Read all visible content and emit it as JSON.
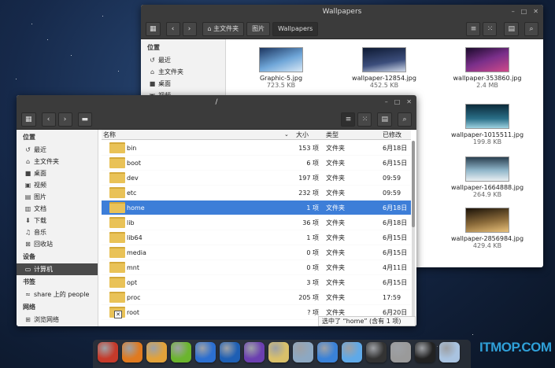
{
  "wallpapers_window": {
    "title": "Wallpapers",
    "window_controls": [
      "–",
      "□",
      "✕"
    ],
    "breadcrumb": [
      "主文件夹",
      "图片",
      "Wallpapers"
    ],
    "sidebar": {
      "header": "位置",
      "items": [
        {
          "icon": "history-icon",
          "glyph": "↺",
          "label": "最近"
        },
        {
          "icon": "home-icon",
          "glyph": "⌂",
          "label": "主文件夹"
        },
        {
          "icon": "desktop-icon",
          "glyph": "■",
          "label": "桌面"
        },
        {
          "icon": "video-icon",
          "glyph": "▣",
          "label": "视频"
        }
      ]
    },
    "files": [
      {
        "name": "Graphic-5.jpg",
        "size": "723.5 KB",
        "color": "#6fa6d8"
      },
      {
        "name": "wallpaper-12854.jpg",
        "size": "452.5 KB",
        "color": "#3c4e7c"
      },
      {
        "name": "wallpaper-353860.jpg",
        "size": "2.4 MB",
        "color": "#7a2f8a"
      },
      {
        "name": "wallpaper-1015511.jpg",
        "size": "199.8 KB",
        "color": "#2a6f88"
      },
      {
        "name": "wallpaper-1664888.jpg",
        "size": "264.9 KB",
        "color": "#8fb5c9"
      },
      {
        "name": "wallpaper-2856984.jpg",
        "size": "429.4 KB",
        "color": "#8a6a3a"
      }
    ]
  },
  "root_window": {
    "title": "/",
    "window_controls": [
      "–",
      "□",
      "✕"
    ],
    "sidebar": {
      "sections": [
        {
          "header": "位置",
          "items": [
            {
              "icon": "history-icon",
              "glyph": "↺",
              "label": "最近"
            },
            {
              "icon": "home-icon",
              "glyph": "⌂",
              "label": "主文件夹"
            },
            {
              "icon": "desktop-icon",
              "glyph": "■",
              "label": "桌面"
            },
            {
              "icon": "video-icon",
              "glyph": "▣",
              "label": "视频"
            },
            {
              "icon": "image-icon",
              "glyph": "▤",
              "label": "图片"
            },
            {
              "icon": "document-icon",
              "glyph": "▥",
              "label": "文档"
            },
            {
              "icon": "download-icon",
              "glyph": "⬇",
              "label": "下载"
            },
            {
              "icon": "music-icon",
              "glyph": "♫",
              "label": "音乐"
            },
            {
              "icon": "trash-icon",
              "glyph": "⊠",
              "label": "回收站"
            }
          ]
        },
        {
          "header": "设备",
          "items": [
            {
              "icon": "computer-icon",
              "glyph": "▭",
              "label": "计算机",
              "selected": true
            }
          ]
        },
        {
          "header": "书签",
          "items": [
            {
              "icon": "network-share-icon",
              "glyph": "≈",
              "label": "share 上的 people"
            }
          ]
        },
        {
          "header": "网络",
          "items": [
            {
              "icon": "browse-network-icon",
              "glyph": "⊞",
              "label": "浏览网络"
            }
          ]
        }
      ]
    },
    "columns": {
      "name": "名称",
      "size": "大小",
      "type": "类型",
      "modified": "已修改"
    },
    "rows": [
      {
        "name": "bin",
        "size": "153 项",
        "type": "文件夹",
        "modified": "6月18日"
      },
      {
        "name": "boot",
        "size": "6 项",
        "type": "文件夹",
        "modified": "6月15日"
      },
      {
        "name": "dev",
        "size": "197 项",
        "type": "文件夹",
        "modified": "09:59"
      },
      {
        "name": "etc",
        "size": "232 项",
        "type": "文件夹",
        "modified": "09:59"
      },
      {
        "name": "home",
        "size": "1 项",
        "type": "文件夹",
        "modified": "6月18日",
        "selected": true
      },
      {
        "name": "lib",
        "size": "36 项",
        "type": "文件夹",
        "modified": "6月18日"
      },
      {
        "name": "lib64",
        "size": "1 项",
        "type": "文件夹",
        "modified": "6月15日"
      },
      {
        "name": "media",
        "size": "0 项",
        "type": "文件夹",
        "modified": "6月15日"
      },
      {
        "name": "mnt",
        "size": "0 项",
        "type": "文件夹",
        "modified": "4月11日"
      },
      {
        "name": "opt",
        "size": "3 项",
        "type": "文件夹",
        "modified": "6月15日"
      },
      {
        "name": "proc",
        "size": "205 项",
        "type": "文件夹",
        "modified": "17:59"
      },
      {
        "name": "root",
        "size": "? 项",
        "type": "文件夹",
        "modified": "6月20日"
      }
    ],
    "status": "选中了 “home” (含有 1 项)"
  },
  "dock": {
    "apps": [
      {
        "icon": "rocket-launcher-icon",
        "color": "#c63a2a"
      },
      {
        "icon": "file-manager-icon",
        "color": "#e07a1f"
      },
      {
        "icon": "target-app-icon",
        "color": "#e2a23a"
      },
      {
        "icon": "leaf-app-icon",
        "color": "#6bb52e"
      },
      {
        "icon": "media-player-icon",
        "color": "#2c6fd0"
      },
      {
        "icon": "web-browser-icon",
        "color": "#1e5fb4"
      },
      {
        "icon": "disk-app-icon",
        "color": "#6b3fb0"
      },
      {
        "icon": "notes-app-icon",
        "color": "#d9c06a"
      },
      {
        "icon": "system-monitor-icon",
        "color": "#8da8c2"
      },
      {
        "icon": "safari-compass-icon",
        "color": "#3a82d8"
      },
      {
        "icon": "finder-face-icon",
        "color": "#5fa9e8"
      },
      {
        "icon": "camera-lens-icon",
        "color": "#333333"
      },
      {
        "icon": "scripting-app-icon",
        "color": "#9a9a9a"
      },
      {
        "icon": "calendar-icon",
        "color": "#222222"
      },
      {
        "icon": "preferences-icon",
        "color": "#a9c3e0"
      }
    ],
    "watermark": "ITMOP.COM"
  }
}
